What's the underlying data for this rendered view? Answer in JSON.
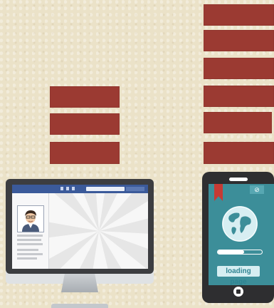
{
  "colors": {
    "background": "#ebe2c8",
    "bar": "#9b3a32",
    "facebook_blue": "#3b5a9a",
    "phone_screen": "#3c8e99"
  },
  "bars": {
    "left_stack_count": 3,
    "right_stack_count": 6
  },
  "monitor": {
    "app": "social-profile-page",
    "profile_icon": "user-avatar-icon"
  },
  "phone": {
    "icons": [
      "bookmark-icon",
      "compass-icon",
      "globe-icon",
      "home-button-icon"
    ],
    "progress": 0.6,
    "loading_label": "loading page"
  }
}
